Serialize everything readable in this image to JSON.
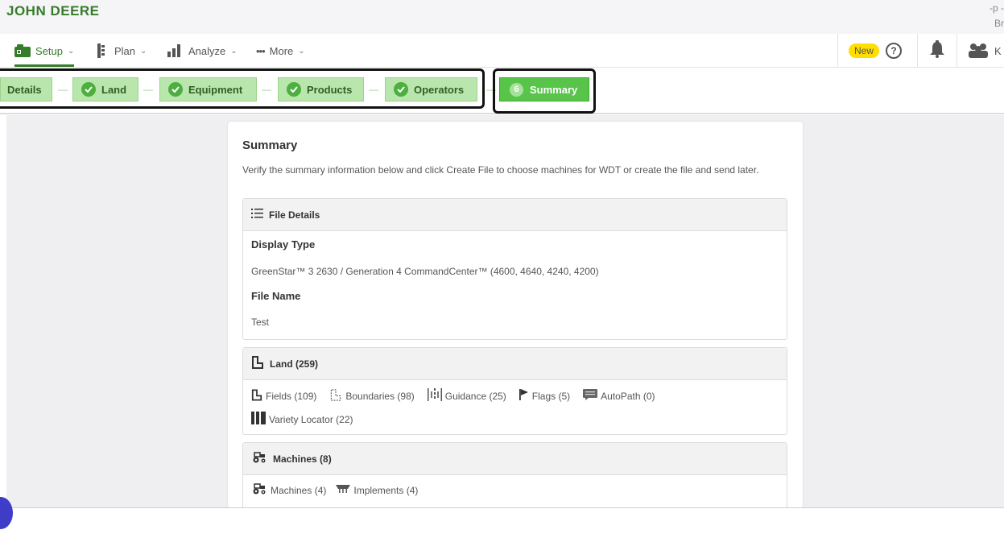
{
  "brand": "JOHN DEERE",
  "top_right": {
    "line1": "-p -",
    "line2": "Br"
  },
  "nav": {
    "setup": "Setup",
    "plan": "Plan",
    "analyze": "Analyze",
    "more": "More",
    "new_badge": "New",
    "help": "?",
    "user_initial": "K"
  },
  "steps": {
    "details": "Details",
    "land": "Land",
    "equipment": "Equipment",
    "products": "Products",
    "operators": "Operators",
    "summary_num": "6",
    "summary": "Summary"
  },
  "summary": {
    "title": "Summary",
    "description": "Verify the summary information below and click Create File to choose machines for WDT or create the file and send later."
  },
  "file_details": {
    "header": "File Details",
    "display_type_label": "Display Type",
    "display_type_value": "GreenStar™ 3 2630 / Generation 4 CommandCenter™ (4600, 4640, 4240, 4200)",
    "file_name_label": "File Name",
    "file_name_value": "Test"
  },
  "land": {
    "header": "Land (259)",
    "fields": "Fields (109)",
    "boundaries": "Boundaries (98)",
    "guidance": "Guidance (25)",
    "flags": "Flags (5)",
    "autopath": "AutoPath (0)",
    "variety_locator": "Variety Locator (22)"
  },
  "machines": {
    "header": "Machines (8)",
    "machines": "Machines (4)",
    "implements": "Implements (4)"
  },
  "colors": {
    "brand_green": "#367c2b",
    "step_green": "#b8e6ac",
    "active_green": "#58c54a",
    "badge_yellow": "#ffde00"
  }
}
